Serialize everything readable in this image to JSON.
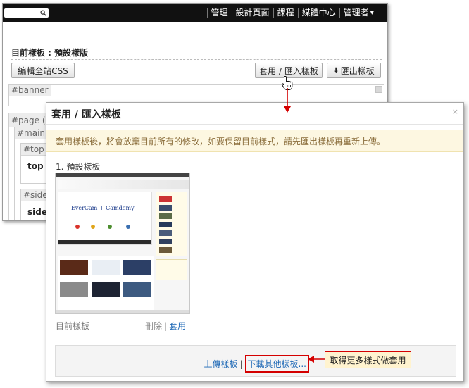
{
  "topnav": {
    "items": [
      "管理",
      "設計頁面",
      "課程",
      "媒體中心",
      "管理者"
    ]
  },
  "editor": {
    "title": "目前樣板 : 預設樣版",
    "edit_css_label": "編輯全站CSS",
    "apply_import_label": "套用 / 匯入樣板",
    "export_label": "匯出樣板",
    "regions": {
      "banner": "#banner",
      "page": "#page (頁",
      "main": "#main (",
      "top": "#top (",
      "top_text": "top 房",
      "sidebar": "#sideb",
      "sidebar_text": "sideb"
    }
  },
  "dialog": {
    "title": "套用 / 匯入樣板",
    "close": "×",
    "warning": "套用樣板後，將會放棄目前所有的修改，如要保留目前樣式，請先匯出樣板再重新上傳。",
    "template_number": "1.",
    "template_name": "預設樣板",
    "thumb_text": "EverCam + Camdemy",
    "current_label": "目前樣板",
    "delete_label": "刪除",
    "separator": "|",
    "apply_label": "套用",
    "upload_label": "上傳樣板",
    "download_label": "下載其他樣板..."
  },
  "callout": {
    "text": "取得更多樣式做套用"
  },
  "colors": {
    "accent_red": "#d40000",
    "link_blue": "#1a66b5",
    "warning_bg": "#fdf7e1",
    "topbar": "#111111"
  }
}
